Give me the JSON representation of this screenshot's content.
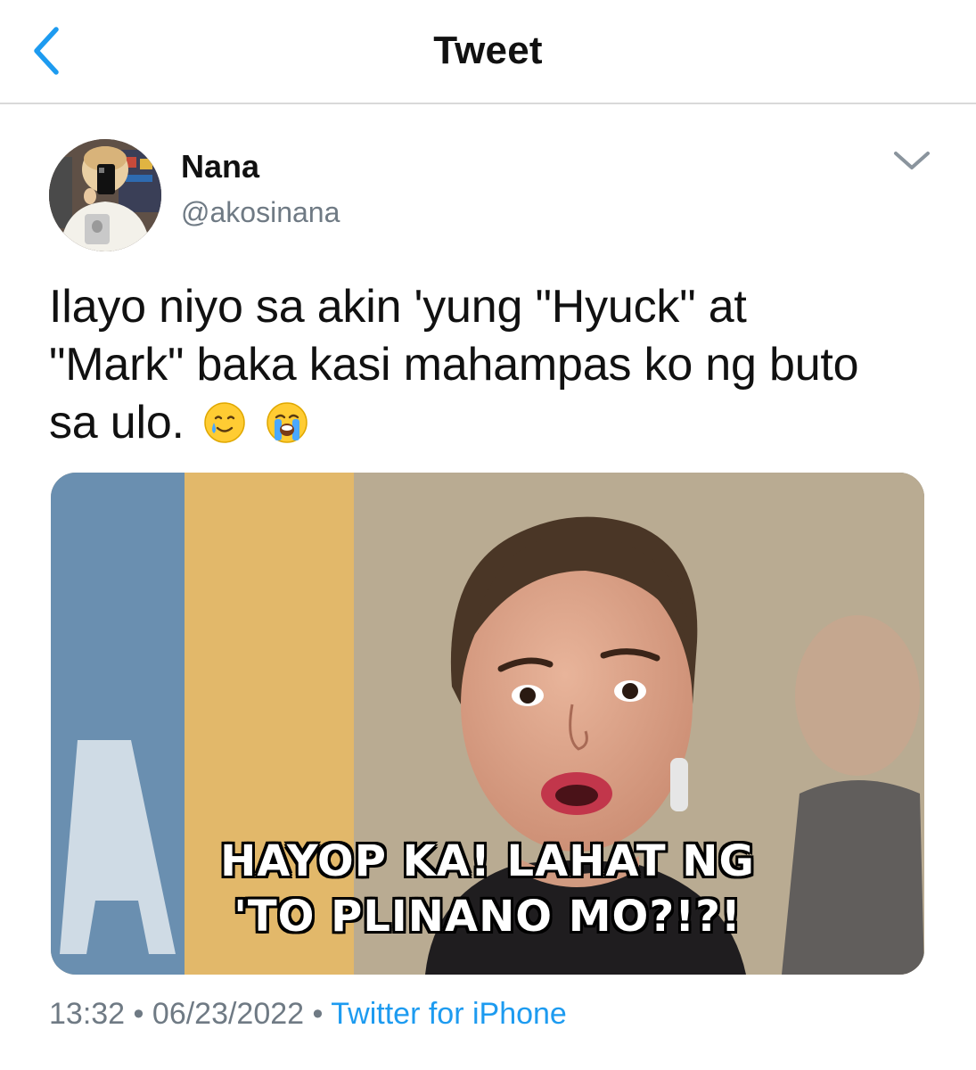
{
  "nav": {
    "title": "Tweet",
    "back_icon": "chevron-left-icon"
  },
  "tweet": {
    "display_name": "Nana",
    "handle": "@akosinana",
    "text_lines": [
      "Ilayo niyo sa akin 'yung \"Hyuck\" at",
      "\"Mark\" baka kasi mahampas ko ng buto",
      "sa ulo."
    ],
    "emojis": [
      "smiling-face-with-tear-emoji",
      "loudly-crying-face-emoji"
    ],
    "more_icon": "chevron-down-icon",
    "media": {
      "caption_lines": [
        "HAYOP KA! LAHAT NG",
        "'TO PLINANO MO?!?!"
      ]
    },
    "time": "13:32",
    "date": "06/23/2022",
    "separator": "•",
    "source": "Twitter for iPhone"
  },
  "colors": {
    "accent": "#1d9bf0",
    "secondary_text": "#6f7a84",
    "divider": "#d9d9d9"
  }
}
